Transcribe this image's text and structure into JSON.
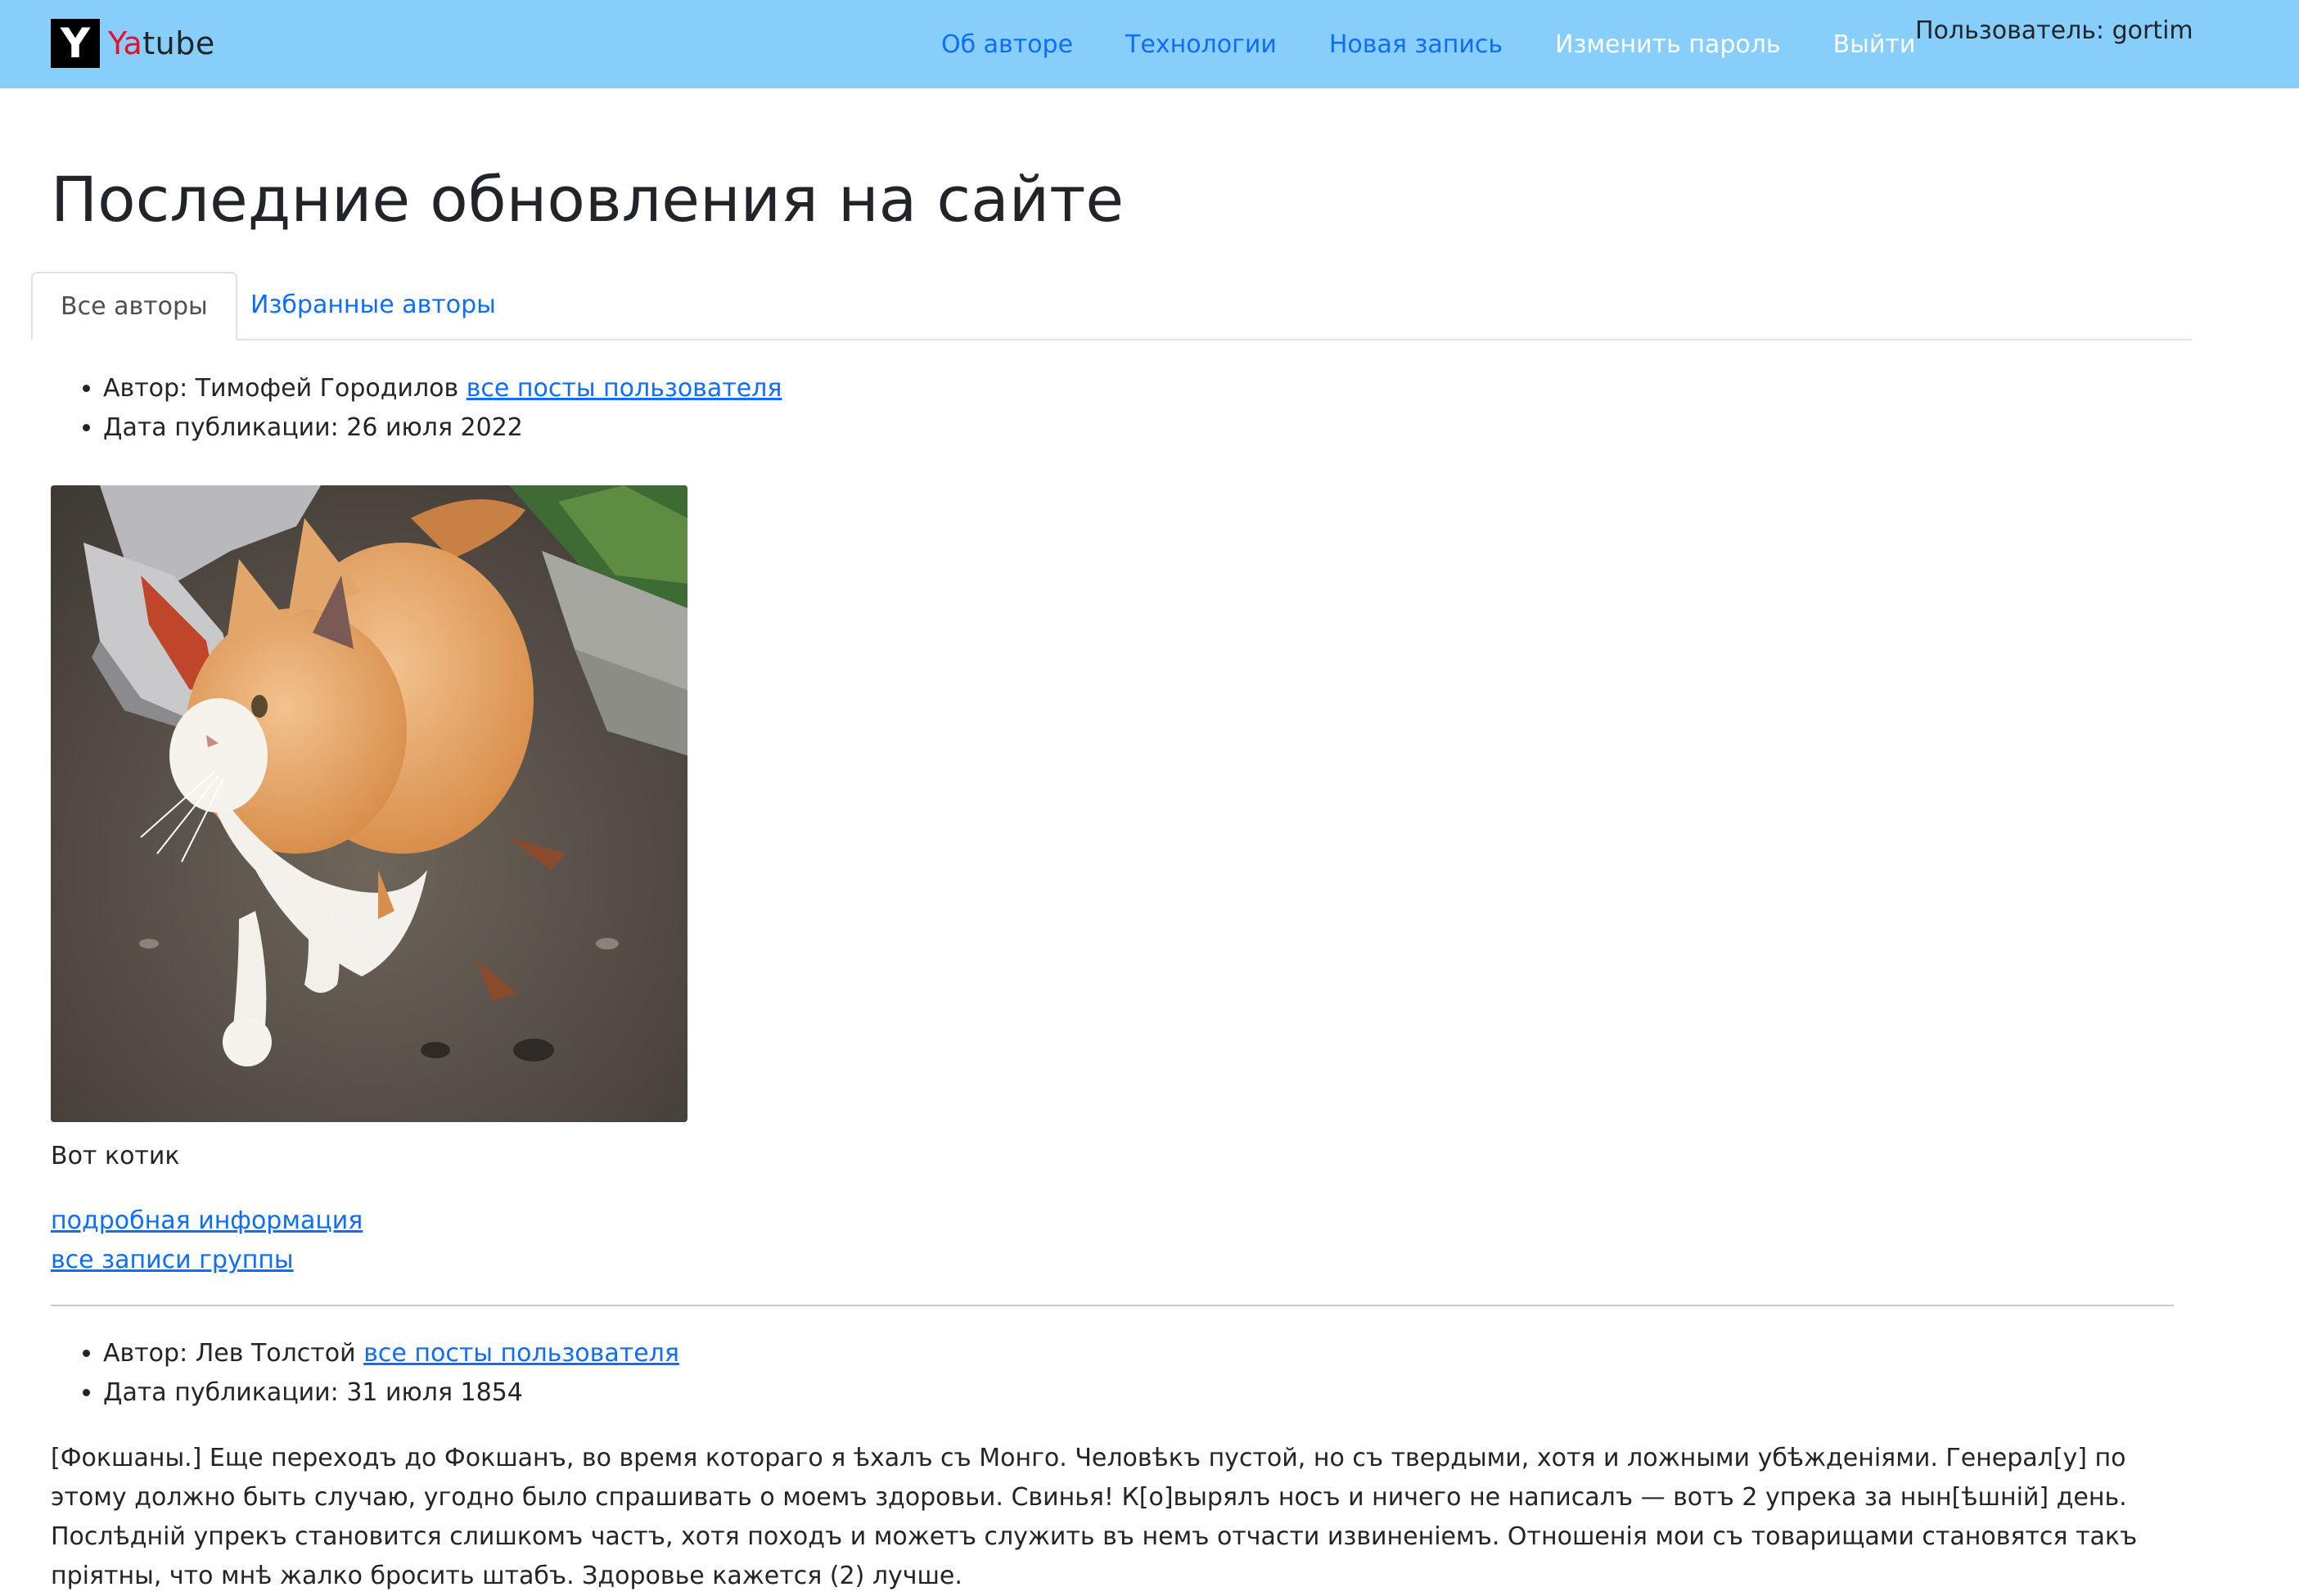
{
  "header": {
    "brand_logo_letter": "Y",
    "brand_prefix": "Ya",
    "brand_suffix": "tube",
    "nav": [
      {
        "label": "Об авторе"
      },
      {
        "label": "Технологии"
      },
      {
        "label": "Новая запись"
      },
      {
        "label": "Изменить пароль"
      },
      {
        "label": "Выйти"
      }
    ],
    "user_label": "Пользователь: gortim",
    "colors": {
      "navbar_bg": "#87cefa",
      "brand_accent": "#e6102a",
      "link": "#0d6efd"
    }
  },
  "page": {
    "title": "Последние обновления на сайте"
  },
  "tabs": [
    {
      "label": "Все авторы",
      "active": true
    },
    {
      "label": "Избранные авторы",
      "active": false
    }
  ],
  "posts": [
    {
      "author_prefix": "Автор: Тимофей Городилов",
      "author_link": "все посты пользователя",
      "date": "Дата публикации: 26 июля 2022",
      "image": "orange-and-white-kitten-photo",
      "text": "Вот котик",
      "details_link": "подробная информация",
      "group_link": "все записи группы"
    },
    {
      "author_prefix": "Автор: Лев Толстой",
      "author_link": "все посты пользователя",
      "date": "Дата публикации: 31 июля 1854",
      "text": "[Фокшаны.] Еще переходъ до Фокшанъ, во время котораго я ѣхалъ съ Монго. Человѣкъ пустой, но съ твердыми, хотя и ложными убѣжденіями. Генерал[у] по этому должно быть случаю, угодно было спрашивать о моемъ здоровьи. Свинья! К[о]вырялъ носъ и ничего не написалъ — вотъ 2 упрека за нын[ѣшній] день. Послѣдній упрекъ становится слишкомъ частъ, хотя походъ и можетъ служить въ немъ отчасти извиненіемъ. Отношенія мои съ товарищами становятся такъ пріятны, что мнѣ жалко бросить штабъ. Здоровье кажется (2) лучше."
    }
  ]
}
